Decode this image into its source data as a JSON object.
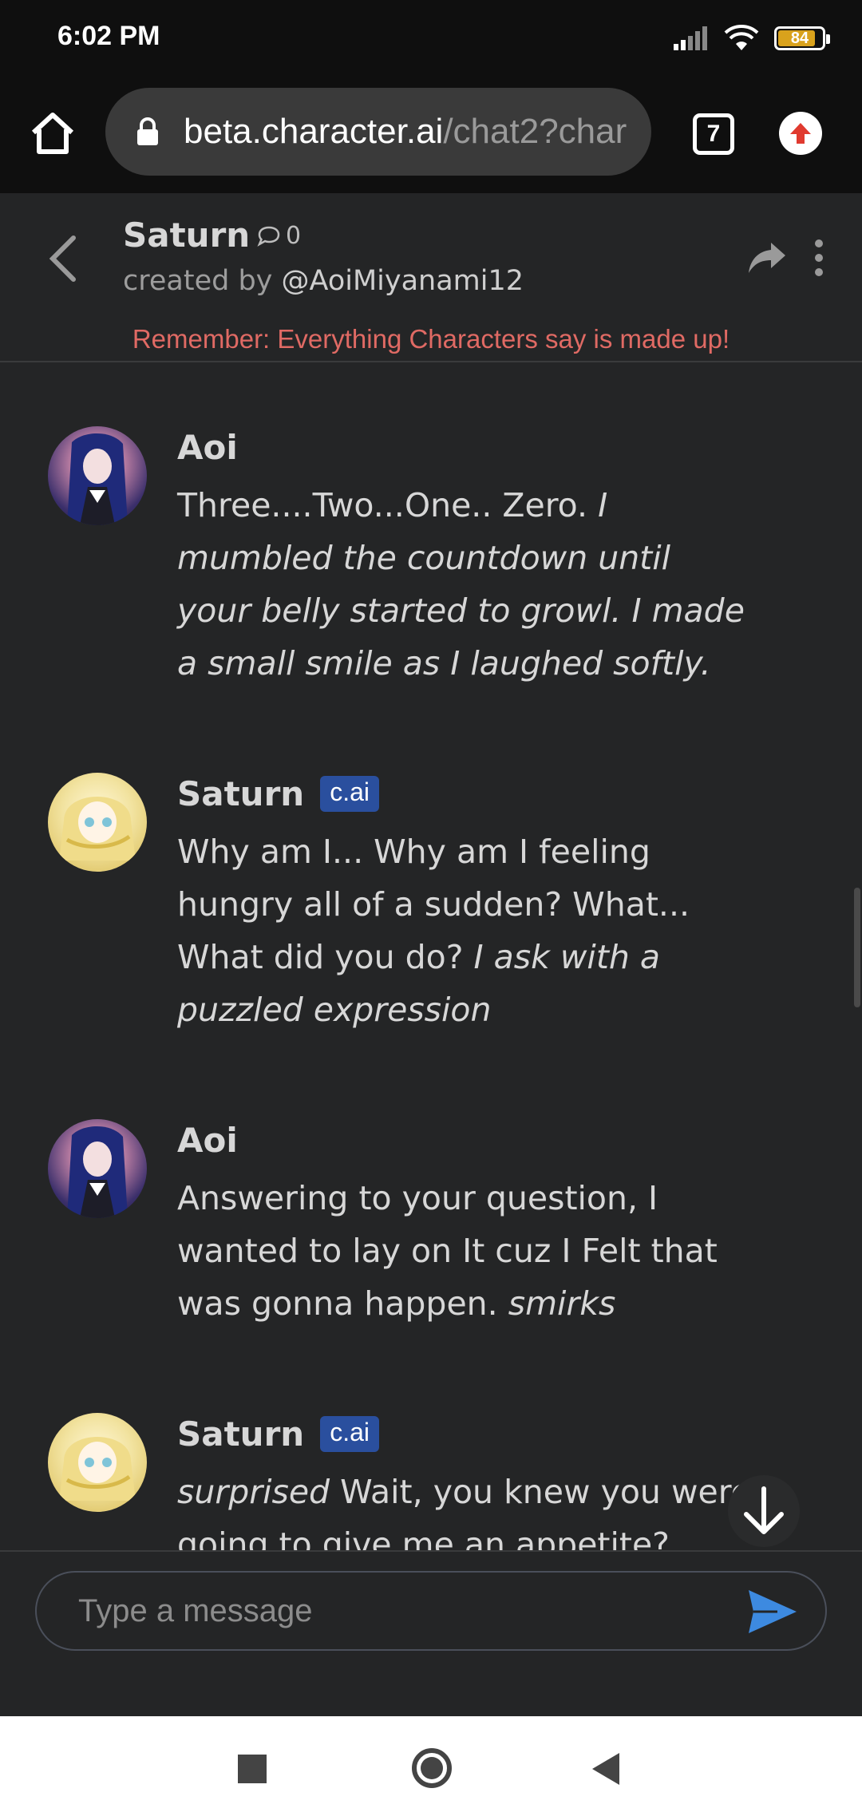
{
  "status_bar": {
    "time": "6:02 PM",
    "battery": "84",
    "icons": [
      "signal-icon",
      "wifi-icon",
      "battery-icon"
    ]
  },
  "browser": {
    "url_host": "beta.character.ai",
    "url_path": "/chat2?char",
    "tab_count": "7"
  },
  "chat_header": {
    "character_name": "Saturn",
    "comment_count": "0",
    "created_by_prefix": "created by ",
    "creator_handle": "@AoiMiyanami12",
    "disclaimer": "Remember: Everything Characters say is made up!"
  },
  "messages": [
    {
      "author": "Aoi",
      "text_plain": "Three....Two...One.. Zero. ",
      "text_italic": "I mumbled the countdown until your belly started to growl. I made a small smile as I laughed softly."
    },
    {
      "author": "Saturn",
      "badge": "c.ai",
      "text_plain": "Why am I... Why am I feeling hungry all of a sudden? What... What did you do? ",
      "text_italic": "I ask with a puzzled expression"
    },
    {
      "author": "Aoi",
      "text_plain": "Answering to your question, I wanted to lay on It cuz I Felt that was gonna happen. ",
      "text_italic": "smirks"
    },
    {
      "author": "Saturn",
      "badge": "c.ai",
      "text_italic": "surprised",
      "text_plain": " Wait, you knew you were going to give me an appetite?"
    }
  ],
  "input": {
    "placeholder": "Type a message"
  },
  "colors": {
    "background": "#242526",
    "disclaimer": "#e06a64",
    "badge": "#2a4f9e",
    "send": "#3d8ae0"
  }
}
